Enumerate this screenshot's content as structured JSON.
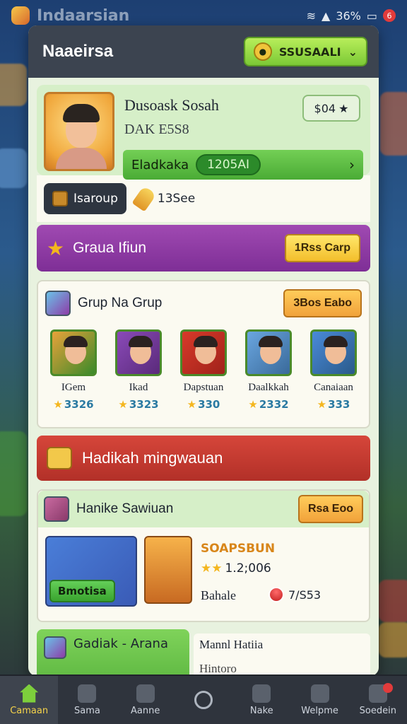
{
  "status_bar": {
    "app_name": "Indaarsian",
    "battery": "36%",
    "notif_count": "6"
  },
  "panel": {
    "title": "Naaeirsa",
    "selector_label": "SSUSAALI"
  },
  "profile": {
    "name": "Dusoask Sosah",
    "id": "DAK E5S8",
    "badge_value": "$04",
    "bar_label": "Eladkaka",
    "bar_value": "1205AI"
  },
  "currency": {
    "group_button": "Isaroup",
    "amount": "13See"
  },
  "event_banner": {
    "title": "Graua Ifiun",
    "button": "1Rss Carp"
  },
  "group": {
    "title": "Grup Na Grup",
    "button": "3Bos Eabo",
    "members": [
      {
        "name": "IGem",
        "score": "3326",
        "colors": [
          "#e8a23a",
          "#3a8a2a"
        ]
      },
      {
        "name": "Ikad",
        "score": "3323",
        "colors": [
          "#8a4ab8",
          "#5a2a7a"
        ]
      },
      {
        "name": "Dapstuan",
        "score": "330",
        "colors": [
          "#d83a2a",
          "#a0221a"
        ]
      },
      {
        "name": "Daalkkah",
        "score": "2332",
        "colors": [
          "#6aa6e0",
          "#3a6a9a"
        ]
      },
      {
        "name": "Canaiaan",
        "score": "333",
        "colors": [
          "#4a8ad8",
          "#2a5a8a"
        ]
      }
    ]
  },
  "bonus_banner": {
    "title": "Hadikah mingwauan"
  },
  "reward": {
    "title": "Hanike Sawiuan",
    "button": "Rsa Eoo",
    "tag": "Bmotisa",
    "name": "SOAPSBUN",
    "stars_value": "1.2;006",
    "sub_label": "Bahale",
    "count": "7/S53"
  },
  "partial": {
    "left_label": "Gadiak - Arana",
    "right_line1": "Mannl Hatiia",
    "right_line2": "Hintoro"
  },
  "nav": [
    {
      "label": "Camaan",
      "active": true
    },
    {
      "label": "Sama",
      "active": false
    },
    {
      "label": "Aanne",
      "active": false
    },
    {
      "label": "",
      "active": false
    },
    {
      "label": "Nake",
      "active": false
    },
    {
      "label": "Welpme",
      "active": false
    },
    {
      "label": "Soedein",
      "active": false
    }
  ],
  "colors": {
    "panel_header": "#3c4450",
    "accent_green": "#7cc936",
    "purple_banner": "#8e3ca4",
    "red_banner": "#c23a30",
    "nav_bg": "#2f343d"
  }
}
